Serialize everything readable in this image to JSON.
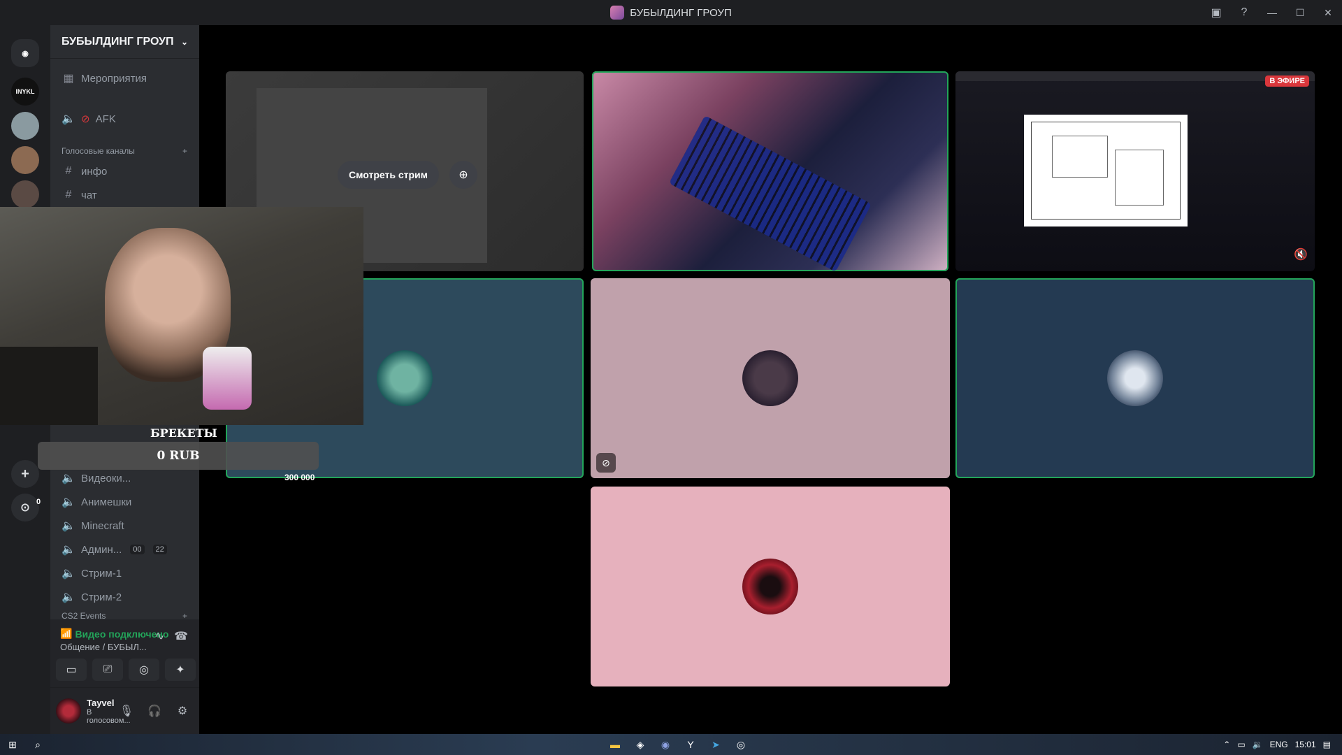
{
  "window": {
    "title": "БУБЫЛДИНГ ГРОУП"
  },
  "sidebar": {
    "server_name": "БУБЫЛДИНГ ГРОУП",
    "events_label": "Мероприятия",
    "afk_label": "AFK",
    "voice_category": "Голосовые каналы",
    "text_channels": [
      "инфо",
      "чат"
    ],
    "voice_channels": [
      {
        "label": "Видеоки..."
      },
      {
        "label": "Анимешки"
      },
      {
        "label": "Minecraft"
      },
      {
        "label": "Админ...",
        "counts": [
          "00",
          "22"
        ]
      },
      {
        "label": "Стрим-1"
      },
      {
        "label": "Стрим-2"
      }
    ],
    "cs2_category": "CS2 Events",
    "explore_count": "0"
  },
  "voice_panel": {
    "status": "Видео подключено",
    "location": "Общение / БУБЫЛ..."
  },
  "user": {
    "name": "Tayvel",
    "status": "В голосовом..."
  },
  "stage": {
    "watch_stream_label": "Смотреть стрим",
    "live_badge": "В ЭФИРЕ"
  },
  "overlay": {
    "title": "БРЕКЕТЫ",
    "amount": "0 RUB",
    "goal": "300 000"
  },
  "taskbar": {
    "lang": "ENG",
    "time": "15:01"
  },
  "colors": {
    "tile_teal": "#2d4a5c",
    "tile_mauve": "#c0a1ab",
    "tile_navy": "#243a52",
    "tile_pink": "#e6b1bd",
    "speaking": "#23a55a",
    "live": "#da373c"
  }
}
